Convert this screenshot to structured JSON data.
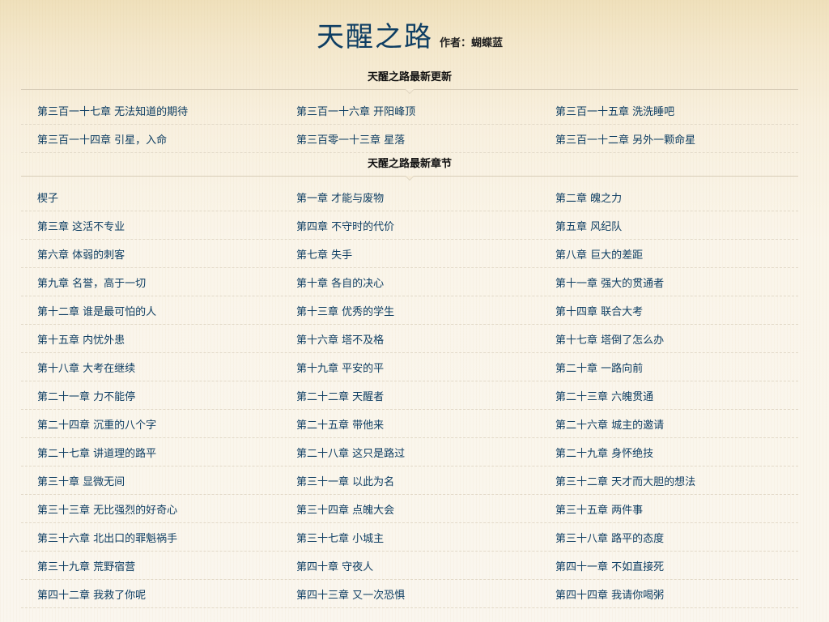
{
  "book": {
    "title": "天醒之路",
    "author_label": "作者：",
    "author": "蝴蝶蓝"
  },
  "latest_updates": {
    "title": "天醒之路最新更新",
    "chapters": [
      "第三百一十七章 无法知道的期待",
      "第三百一十六章 开阳峰顶",
      "第三百一十五章 洗洗睡吧",
      "第三百一十四章 引星，入命",
      "第三百零一十三章 星落",
      "第三百一十二章 另外一颗命星"
    ]
  },
  "latest_chapters": {
    "title": "天醒之路最新章节",
    "chapters": [
      "楔子",
      "第一章 才能与废物",
      "第二章 魄之力",
      "第三章 这活不专业",
      "第四章 不守时的代价",
      "第五章 风纪队",
      "第六章 体弱的刺客",
      "第七章 失手",
      "第八章 巨大的差距",
      "第九章 名誉，高于一切",
      "第十章 各自的决心",
      "第十一章 强大的贯通者",
      "第十二章 谁是最可怕的人",
      "第十三章 优秀的学生",
      "第十四章 联合大考",
      "第十五章 内忧外患",
      "第十六章 塔不及格",
      "第十七章 塔倒了怎么办",
      "第十八章 大考在继续",
      "第十九章 平安的平",
      "第二十章 一路向前",
      "第二十一章 力不能停",
      "第二十二章 天醒者",
      "第二十三章 六魄贯通",
      "第二十四章 沉重的八个字",
      "第二十五章 带他来",
      "第二十六章 城主的邀请",
      "第二十七章 讲道理的路平",
      "第二十八章 这只是路过",
      "第二十九章 身怀绝技",
      "第三十章 显微无间",
      "第三十一章 以此为名",
      "第三十二章 天才而大胆的想法",
      "第三十三章 无比强烈的好奇心",
      "第三十四章 点魄大会",
      "第三十五章 两件事",
      "第三十六章 北出口的罪魁祸手",
      "第三十七章 小城主",
      "第三十八章 路平的态度",
      "第三十九章 荒野宿营",
      "第四十章 守夜人",
      "第四十一章 不如直接死",
      "第四十二章 我救了你呢",
      "第四十三章 又一次恐惧",
      "第四十四章 我请你喝粥"
    ]
  }
}
